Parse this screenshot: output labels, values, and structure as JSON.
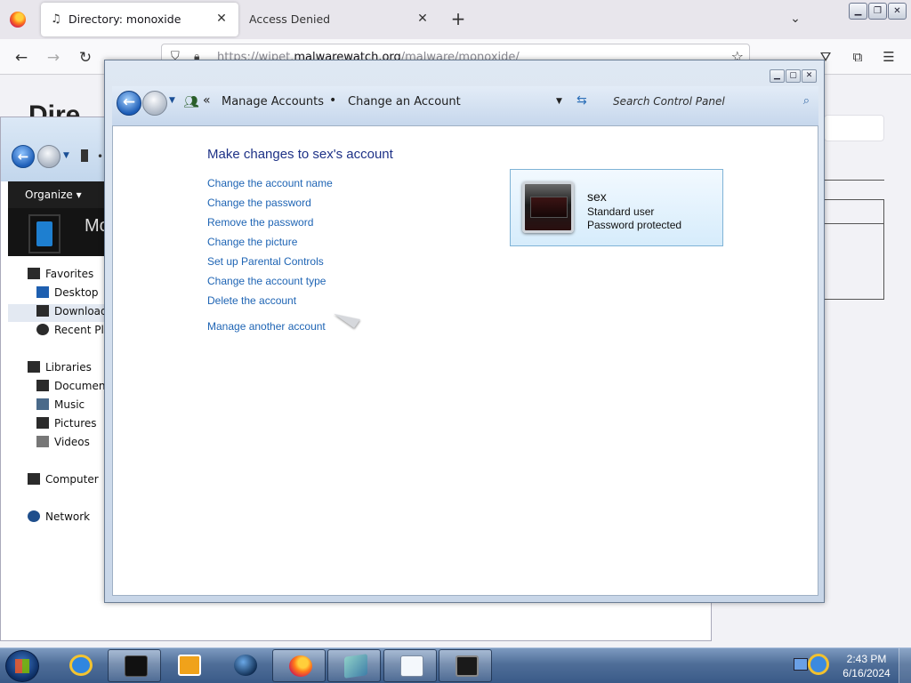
{
  "browser": {
    "tabs": [
      {
        "title": "Directory: monoxide",
        "active": true
      },
      {
        "title": "Access Denied",
        "active": false
      }
    ],
    "url_prefix": "https://wipet.",
    "url_domain": "malwarewatch.org",
    "url_path": "/malware/monoxide/"
  },
  "webpage": {
    "heading": "Dire"
  },
  "explorer": {
    "organize_label": "Organize",
    "banner_text": "Mo",
    "nav": [
      {
        "label": "Favorites",
        "kind": "group"
      },
      {
        "label": "Desktop",
        "kind": "item"
      },
      {
        "label": "Downloads",
        "kind": "item",
        "selected": true
      },
      {
        "label": "Recent Plac",
        "kind": "item"
      },
      {
        "label": "Libraries",
        "kind": "group"
      },
      {
        "label": "Document",
        "kind": "item"
      },
      {
        "label": "Music",
        "kind": "item"
      },
      {
        "label": "Pictures",
        "kind": "item"
      },
      {
        "label": "Videos",
        "kind": "item"
      },
      {
        "label": "Computer",
        "kind": "group"
      },
      {
        "label": "Network",
        "kind": "group"
      }
    ]
  },
  "control_panel": {
    "breadcrumb": [
      "Manage Accounts",
      "Change an Account"
    ],
    "search_placeholder": "Search Control Panel",
    "heading": "Make changes to sex's account",
    "links": [
      "Change the account name",
      "Change the password",
      "Remove the password",
      "Change the picture",
      "Set up Parental Controls",
      "Change the account type",
      "Delete the account",
      "Manage another account"
    ],
    "account": {
      "name": "sex",
      "type": "Standard user",
      "status": "Password protected"
    },
    "colors": {
      "link": "#1e64b4",
      "heading": "#1e3287"
    }
  },
  "taskbar": {
    "items": [
      {
        "icon": "internet-explorer-icon",
        "open": false
      },
      {
        "icon": "monoxide-app-icon",
        "open": true
      },
      {
        "icon": "media-player-icon",
        "open": false
      },
      {
        "icon": "globe-icon",
        "open": false
      },
      {
        "icon": "firefox-icon",
        "open": true
      },
      {
        "icon": "control-panel-icon",
        "open": true
      },
      {
        "icon": "notepad-icon",
        "open": true
      },
      {
        "icon": "terminal-icon",
        "open": true
      }
    ],
    "time": "2:43 PM",
    "date": "6/16/2024"
  }
}
